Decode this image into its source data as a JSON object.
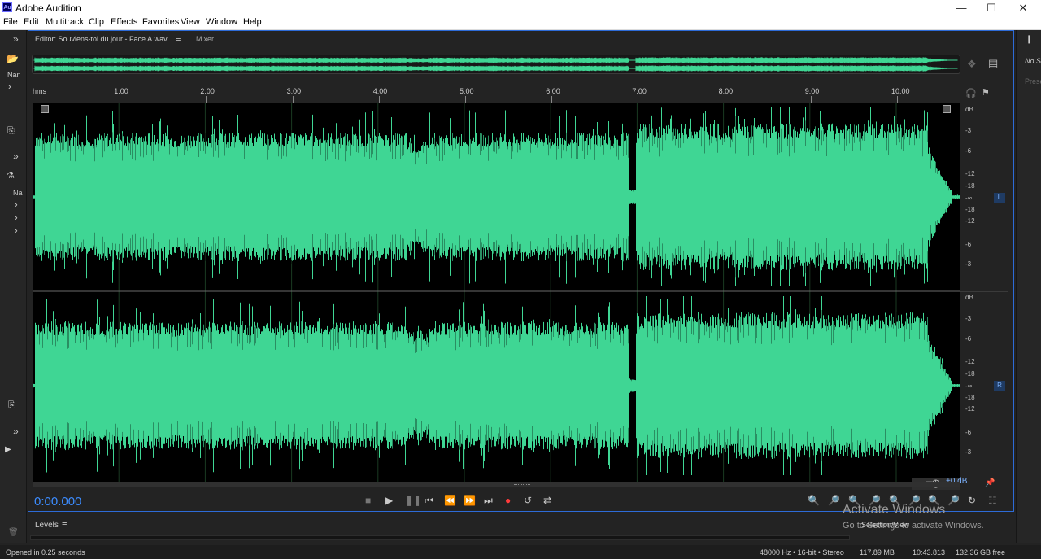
{
  "app": {
    "title": "Adobe Audition",
    "icon_text": "Au"
  },
  "window_controls": {
    "minimize": "—",
    "maximize": "☐",
    "close": "✕"
  },
  "menu": [
    "File",
    "Edit",
    "Multitrack",
    "Clip",
    "Effects",
    "Favorites",
    "View",
    "Window",
    "Help"
  ],
  "left_panel": {
    "collapse": "»",
    "label_1": "Nan",
    "label_2": "Na",
    "chevron": "›"
  },
  "right_panel": {
    "label_1": "No S",
    "label_2": "Prese"
  },
  "editor": {
    "tab_editor": "Editor: Souviens-toi du jour - Face A.wav",
    "tab_menu": "≡",
    "tab_mixer": "Mixer"
  },
  "ruler": {
    "unit": "hms",
    "ticks": [
      "1:00",
      "2:00",
      "3:00",
      "4:00",
      "5:00",
      "6:00",
      "7:00",
      "8:00",
      "9:00",
      "10:00"
    ]
  },
  "db_scale": {
    "header": "dB",
    "labels_top": [
      "-3",
      "-6",
      "-12",
      "-18",
      "-∞",
      "-18",
      "-12",
      "-6",
      "-3"
    ],
    "labels_bottom": [
      "-3",
      "-6",
      "-12",
      "-18",
      "-∞",
      "-18",
      "-12",
      "-6",
      "-3"
    ],
    "channel_left": "L",
    "channel_right": "R"
  },
  "waveform": {
    "color": "#3fd694",
    "duration_label": "10:43.813"
  },
  "transport": {
    "timecode": "0:00.000",
    "volume": "+0 dB"
  },
  "levels": {
    "label": "Levels",
    "menu": "≡"
  },
  "selection_view": "Selection/View",
  "watermark": {
    "line1": "Activate Windows",
    "line2": "Go to Settings to activate Windows."
  },
  "status": {
    "left": "Opened in 0.25 seconds",
    "format": "48000 Hz • 16-bit • Stereo",
    "size": "117.89 MB",
    "duration": "10:43.813",
    "free": "132.36 GB free"
  }
}
